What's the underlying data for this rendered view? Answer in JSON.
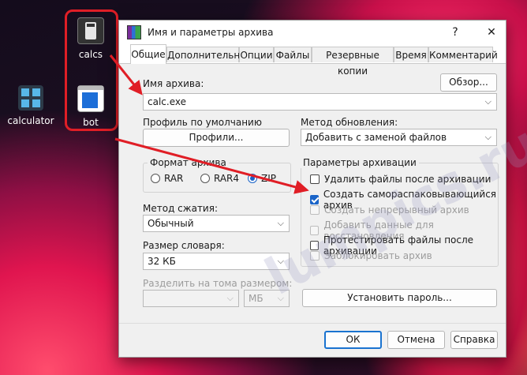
{
  "desktop": {
    "icons": [
      {
        "label": "calcs",
        "icon": "calculator-exe-icon"
      },
      {
        "label": "bot",
        "icon": "window-app-icon"
      },
      {
        "label": "calculator",
        "icon": "calculator-app-icon"
      }
    ]
  },
  "watermark": "lumpics.ru",
  "dialog": {
    "title": "Имя и параметры архива",
    "help": "?",
    "close": "✕",
    "tabs": [
      "Общие",
      "Дополнительно",
      "Опции",
      "Файлы",
      "Резервные копии",
      "Время",
      "Комментарий"
    ],
    "active_tab": 0,
    "archive_name_label": "Имя архива:",
    "browse_button": "Обзор...",
    "archive_name_value": "calc.exe",
    "profile_label": "Профиль по умолчанию",
    "profiles_button": "Профили...",
    "update_method_label": "Метод обновления:",
    "update_method_value": "Добавить с заменой файлов",
    "format_group": "Формат архива",
    "formats": [
      {
        "label": "RAR",
        "selected": false
      },
      {
        "label": "RAR4",
        "selected": false
      },
      {
        "label": "ZIP",
        "selected": true
      }
    ],
    "compression_label": "Метод сжатия:",
    "compression_value": "Обычный",
    "dictionary_label": "Размер словаря:",
    "dictionary_value": "32 КБ",
    "split_label": "Разделить на тома размером:",
    "split_value": "",
    "split_unit": "МБ",
    "params_group": "Параметры архивации",
    "options": [
      {
        "label": "Удалить файлы после архивации",
        "checked": false,
        "enabled": true
      },
      {
        "label": "Создать самораспаковывающийся архив",
        "checked": true,
        "enabled": true
      },
      {
        "label": "Создать непрерывный архив",
        "checked": false,
        "enabled": false
      },
      {
        "label": "Добавить данные для восстановления",
        "checked": false,
        "enabled": false
      },
      {
        "label": "Протестировать файлы после архивации",
        "checked": false,
        "enabled": true
      },
      {
        "label": "Заблокировать архив",
        "checked": false,
        "enabled": false
      }
    ],
    "password_button": "Установить пароль...",
    "ok": "ОК",
    "cancel": "Отмена",
    "help_button": "Справка"
  },
  "colors": {
    "accent": "#1a64c8",
    "annotation": "#e01e26"
  }
}
